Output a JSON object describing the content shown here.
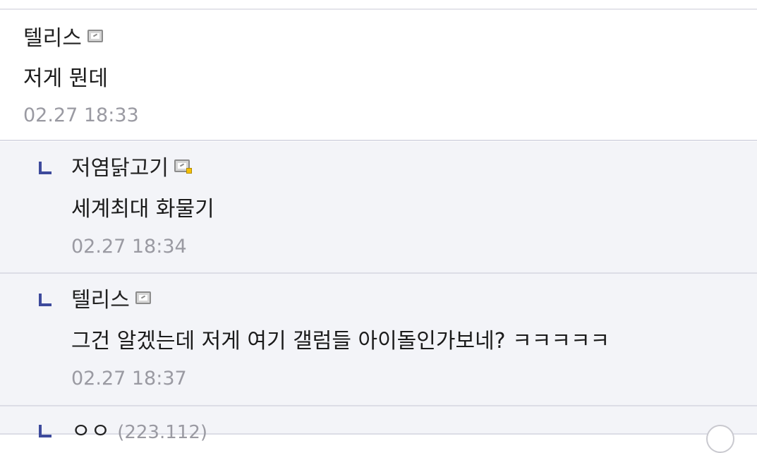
{
  "comments": [
    {
      "nick": "텔리스",
      "icon": "gallog-icon",
      "text": "저게 뭔데",
      "date": "02.27 18:33"
    }
  ],
  "replies": [
    {
      "nick": "저염닭고기",
      "icon": "gallog-fixed-icon",
      "text": "세계최대 화물기",
      "date": "02.27 18:34"
    },
    {
      "nick": "텔리스",
      "icon": "gallog-icon",
      "text": "그건 알겠는데 저게 여기 갤럼들 아이돌인가보네? ㅋㅋㅋㅋㅋ",
      "date": "02.27 18:37"
    },
    {
      "nick": "ㅇㅇ",
      "ip": "(223.112)"
    }
  ]
}
